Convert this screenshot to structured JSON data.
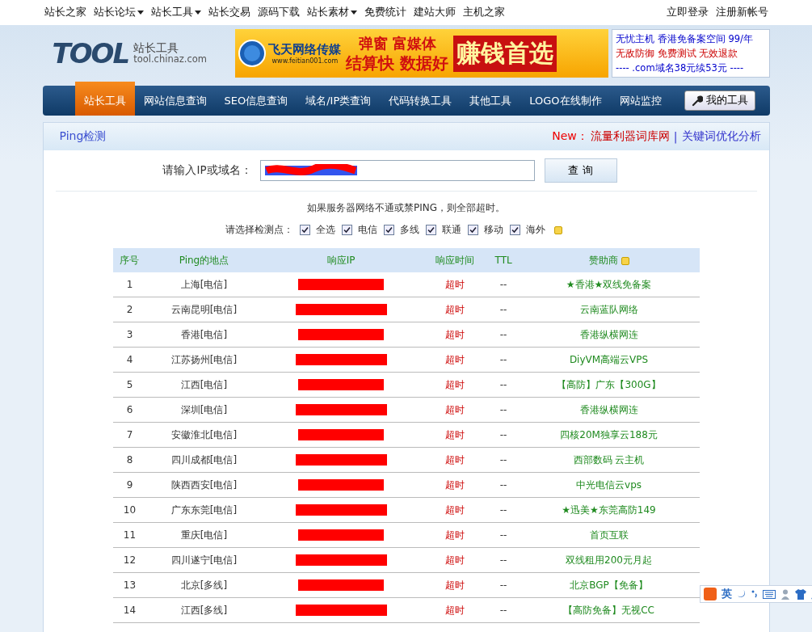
{
  "top_nav": {
    "items": [
      {
        "label": "站长之家",
        "dropdown": false
      },
      {
        "label": "站长论坛",
        "dropdown": true
      },
      {
        "label": "站长工具",
        "dropdown": true
      },
      {
        "label": "站长交易",
        "dropdown": false
      },
      {
        "label": "源码下载",
        "dropdown": false
      },
      {
        "label": "站长素材",
        "dropdown": true
      },
      {
        "label": "免费统计",
        "dropdown": false
      },
      {
        "label": "建站大师",
        "dropdown": false
      },
      {
        "label": "主机之家",
        "dropdown": false
      }
    ],
    "account": [
      "立即登录",
      "注册新帐号"
    ]
  },
  "logo": {
    "wordmark": "TOOL",
    "title": "站长工具",
    "domain": "tool.chinaz.com"
  },
  "banner": {
    "brand": "飞天网络传媒",
    "url": "www.feitian001.com",
    "line1": "弹窗 富媒体",
    "line2": "结算快 数据好",
    "slogan": "赚钱首选"
  },
  "text_ad": [
    {
      "text": "无忧主机 香港免备案空间 99/年",
      "highlight": false
    },
    {
      "text": "无敌防御 免费测试 无效退款",
      "highlight": true
    },
    {
      "text": "---- .com域名38元续53元 ----",
      "highlight": false
    }
  ],
  "main_nav": {
    "items": [
      {
        "label": "站长工具",
        "selected": true
      },
      {
        "label": "网站信息查询",
        "selected": false
      },
      {
        "label": "SEO信息查询",
        "selected": false
      },
      {
        "label": "域名/IP类查询",
        "selected": false
      },
      {
        "label": "代码转换工具",
        "selected": false
      },
      {
        "label": "其他工具",
        "selected": false
      },
      {
        "label": "LOGO在线制作",
        "selected": false
      },
      {
        "label": "网站监控",
        "selected": false
      }
    ],
    "my_tools": "我的工具"
  },
  "panel": {
    "title": "Ping检测",
    "new_label": "New：",
    "links": [
      {
        "label": "流量利器词库网",
        "color": "#cc0000"
      },
      {
        "label": "关键词优化分析",
        "color": "#3333cc"
      }
    ],
    "separator": "|"
  },
  "form": {
    "label": "请输入IP或域名：",
    "submit": "查 询",
    "note": "如果服务器网络不通或禁PING，则全部超时。",
    "points_label": "请选择检测点：",
    "points": [
      {
        "label": "全选",
        "checked": true,
        "help": false
      },
      {
        "label": "电信",
        "checked": true,
        "help": false
      },
      {
        "label": "多线",
        "checked": true,
        "help": false
      },
      {
        "label": "联通",
        "checked": true,
        "help": false
      },
      {
        "label": "移动",
        "checked": true,
        "help": false
      },
      {
        "label": "海外",
        "checked": true,
        "help": true
      }
    ]
  },
  "table": {
    "columns": [
      {
        "label": "序号",
        "help": false
      },
      {
        "label": "Ping的地点",
        "help": false
      },
      {
        "label": "响应IP",
        "help": false
      },
      {
        "label": "响应时间",
        "help": false
      },
      {
        "label": "TTL",
        "help": false
      },
      {
        "label": "赞助商",
        "help": true
      }
    ],
    "rows": [
      {
        "no": "1",
        "location": "上海[电信]",
        "time": "超时",
        "ttl": "--",
        "sponsor": "★香港★双线免备案"
      },
      {
        "no": "2",
        "location": "云南昆明[电信]",
        "time": "超时",
        "ttl": "--",
        "sponsor": "云南蓝队网络"
      },
      {
        "no": "3",
        "location": "香港[电信]",
        "time": "超时",
        "ttl": "--",
        "sponsor": "香港纵横网连"
      },
      {
        "no": "4",
        "location": "江苏扬州[电信]",
        "time": "超时",
        "ttl": "--",
        "sponsor": "DiyVM高端云VPS"
      },
      {
        "no": "5",
        "location": "江西[电信]",
        "time": "超时",
        "ttl": "--",
        "sponsor": "【高防】广东【300G】"
      },
      {
        "no": "6",
        "location": "深圳[电信]",
        "time": "超时",
        "ttl": "--",
        "sponsor": "香港纵横网连"
      },
      {
        "no": "7",
        "location": "安徽淮北[电信]",
        "time": "超时",
        "ttl": "--",
        "sponsor": "四核20M独享云188元"
      },
      {
        "no": "8",
        "location": "四川成都[电信]",
        "time": "超时",
        "ttl": "--",
        "sponsor": "西部数码 云主机"
      },
      {
        "no": "9",
        "location": "陕西西安[电信]",
        "time": "超时",
        "ttl": "--",
        "sponsor": "中光电信云vps"
      },
      {
        "no": "10",
        "location": "广东东莞[电信]",
        "time": "超时",
        "ttl": "--",
        "sponsor": "★迅美★东莞高防149"
      },
      {
        "no": "11",
        "location": "重庆[电信]",
        "time": "超时",
        "ttl": "--",
        "sponsor": "首页互联"
      },
      {
        "no": "12",
        "location": "四川遂宁[电信]",
        "time": "超时",
        "ttl": "--",
        "sponsor": "双线租用200元月起"
      },
      {
        "no": "13",
        "location": "北京[多线]",
        "time": "超时",
        "ttl": "--",
        "sponsor": "北京BGP【免备】"
      },
      {
        "no": "14",
        "location": "江西[多线]",
        "time": "超时",
        "ttl": "--",
        "sponsor": "【高防免备】无视CC"
      }
    ]
  },
  "ime_bar": {
    "mode": "英"
  }
}
